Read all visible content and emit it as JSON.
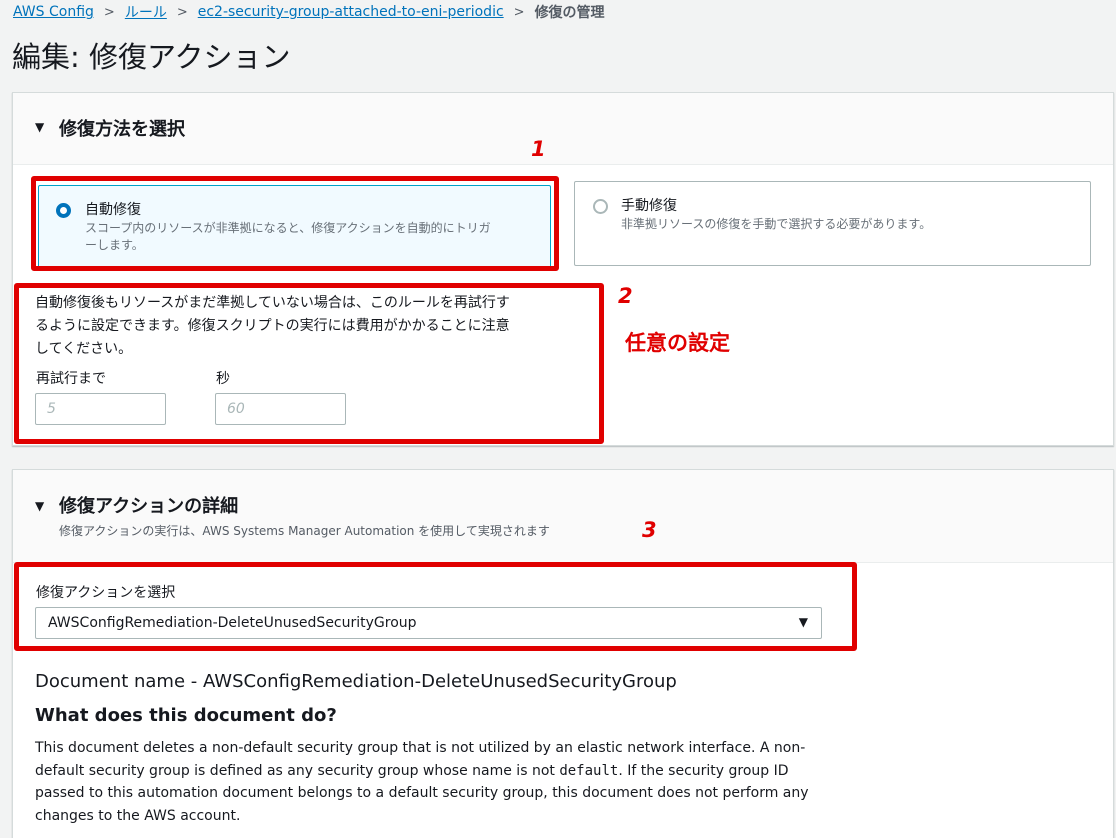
{
  "breadcrumb": {
    "items": [
      "AWS Config",
      "ルール",
      "ec2-security-group-attached-to-eni-periodic"
    ],
    "current": "修復の管理"
  },
  "page_title": "編集: 修復アクション",
  "method_panel": {
    "title": "修復方法を選択",
    "auto": {
      "title": "自動修復",
      "desc_line1": "スコープ内のリソースが非準拠になると、修復アクションを自動的にトリガ",
      "desc_line2": "ーします。",
      "selected": true
    },
    "manual": {
      "title": "手動修復",
      "desc": "非準拠リソースの修復を手動で選択する必要があります。",
      "selected": false
    },
    "retry_text_line1": "自動修復後もリソースがまだ準拠していない場合は、このルールを再試行す",
    "retry_text_line2": "るように設定できます。修復スクリプトの実行には費用がかかることに注意",
    "retry_text_line3": "してください。",
    "retries_label": "再試行まで",
    "retries_placeholder": "5",
    "seconds_label": "秒",
    "seconds_placeholder": "60"
  },
  "details_panel": {
    "title": "修復アクションの詳細",
    "subtitle": "修復アクションの実行は、AWS Systems Manager Automation を使用して実現されます",
    "select_label": "修復アクションを選択",
    "select_value": "AWSConfigRemediation-DeleteUnusedSecurityGroup",
    "document_name": "Document name - AWSConfigRemediation-DeleteUnusedSecurityGroup",
    "what_heading": "What does this document do?",
    "body_part1": "This document deletes a non-default security group that is not utilized by an elastic network interface. A non-default security group is defined as any security group whose name is not ",
    "body_code": "default",
    "body_part2": ". If the security group ID passed to this automation document belongs to a default security group, this document does not perform any changes to the AWS account."
  },
  "annotations": {
    "num1": "1",
    "num2": "2",
    "num3": "3",
    "optional_note": "任意の設定",
    "color": "#e00000"
  },
  "colors": {
    "link": "#0073bb",
    "selected_tile_bg": "#f1faff",
    "page_bg": "#f2f3f3"
  }
}
